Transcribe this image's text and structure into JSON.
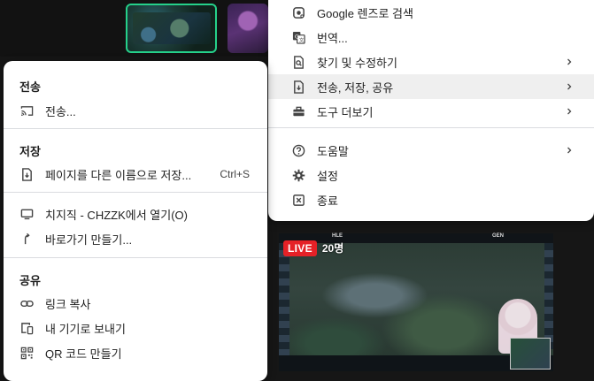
{
  "background": {
    "live_label": "LIVE",
    "viewer_count": "20명",
    "team_left": "HLE",
    "team_right": "GEN"
  },
  "main_menu": {
    "items": [
      {
        "label": "Google 렌즈로 검색",
        "icon": "lens-icon",
        "submenu": false
      },
      {
        "label": "번역...",
        "icon": "translate-icon",
        "submenu": false
      },
      {
        "label": "찾기 및 수정하기",
        "icon": "find-icon",
        "submenu": true
      },
      {
        "label": "전송, 저장, 공유",
        "icon": "cast-save-share-icon",
        "submenu": true,
        "highlighted": true
      },
      {
        "label": "도구 더보기",
        "icon": "toolbox-icon",
        "submenu": true
      },
      {
        "label": "도움말",
        "icon": "help-icon",
        "submenu": true
      },
      {
        "label": "설정",
        "icon": "gear-icon",
        "submenu": false
      },
      {
        "label": "종료",
        "icon": "exit-icon",
        "submenu": false
      }
    ]
  },
  "sub_menu": {
    "cast_section": {
      "title": "전송",
      "items": [
        {
          "label": "전송...",
          "icon": "cast-icon"
        }
      ]
    },
    "save_section": {
      "title": "저장",
      "items": [
        {
          "label": "페이지를 다른 이름으로 저장...",
          "icon": "save-page-icon",
          "shortcut": "Ctrl+S"
        },
        {
          "label": "치지직 - CHZZK에서 열기(O)",
          "icon": "monitor-icon"
        },
        {
          "label": "바로가기 만들기...",
          "icon": "shortcut-icon"
        }
      ]
    },
    "share_section": {
      "title": "공유",
      "items": [
        {
          "label": "링크 복사",
          "icon": "link-icon"
        },
        {
          "label": "내 기기로 보내기",
          "icon": "send-device-icon"
        },
        {
          "label": "QR 코드 만들기",
          "icon": "qr-code-icon"
        }
      ]
    }
  }
}
